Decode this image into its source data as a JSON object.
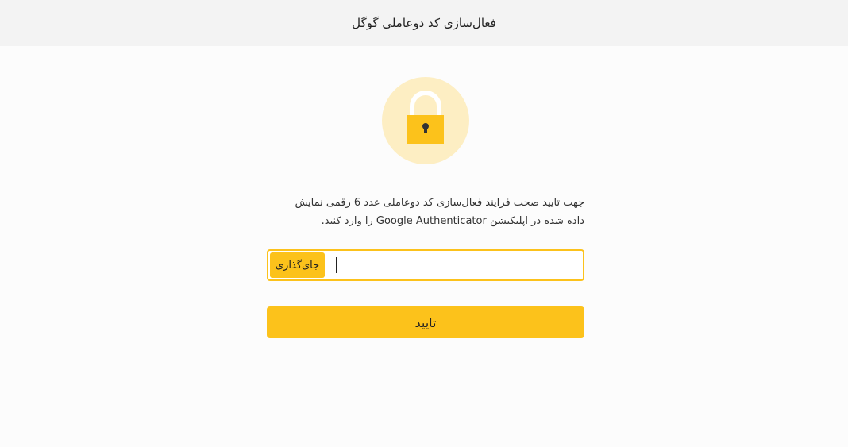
{
  "header": {
    "title": "فعال‌سازی کد دوعاملی گوگل"
  },
  "lock_icon": {
    "icon": "padlock-icon",
    "circle_color": "#fdeec3",
    "lock_color": "#fcc21b"
  },
  "description": {
    "line1": "جهت تایید صحت فرایند فعال‌سازی کد دوعاملی عدد 6 رقمی نمایش",
    "line2": "داده شده در اپلیکیشن Google Authenticator را وارد کنید."
  },
  "code_field": {
    "value": "",
    "paste_label": "جای‌گذاری"
  },
  "submit": {
    "label": "تایید"
  },
  "colors": {
    "accent": "#fcc21b",
    "header_bg": "#f3f3f3",
    "page_bg": "#fcfcfc"
  }
}
